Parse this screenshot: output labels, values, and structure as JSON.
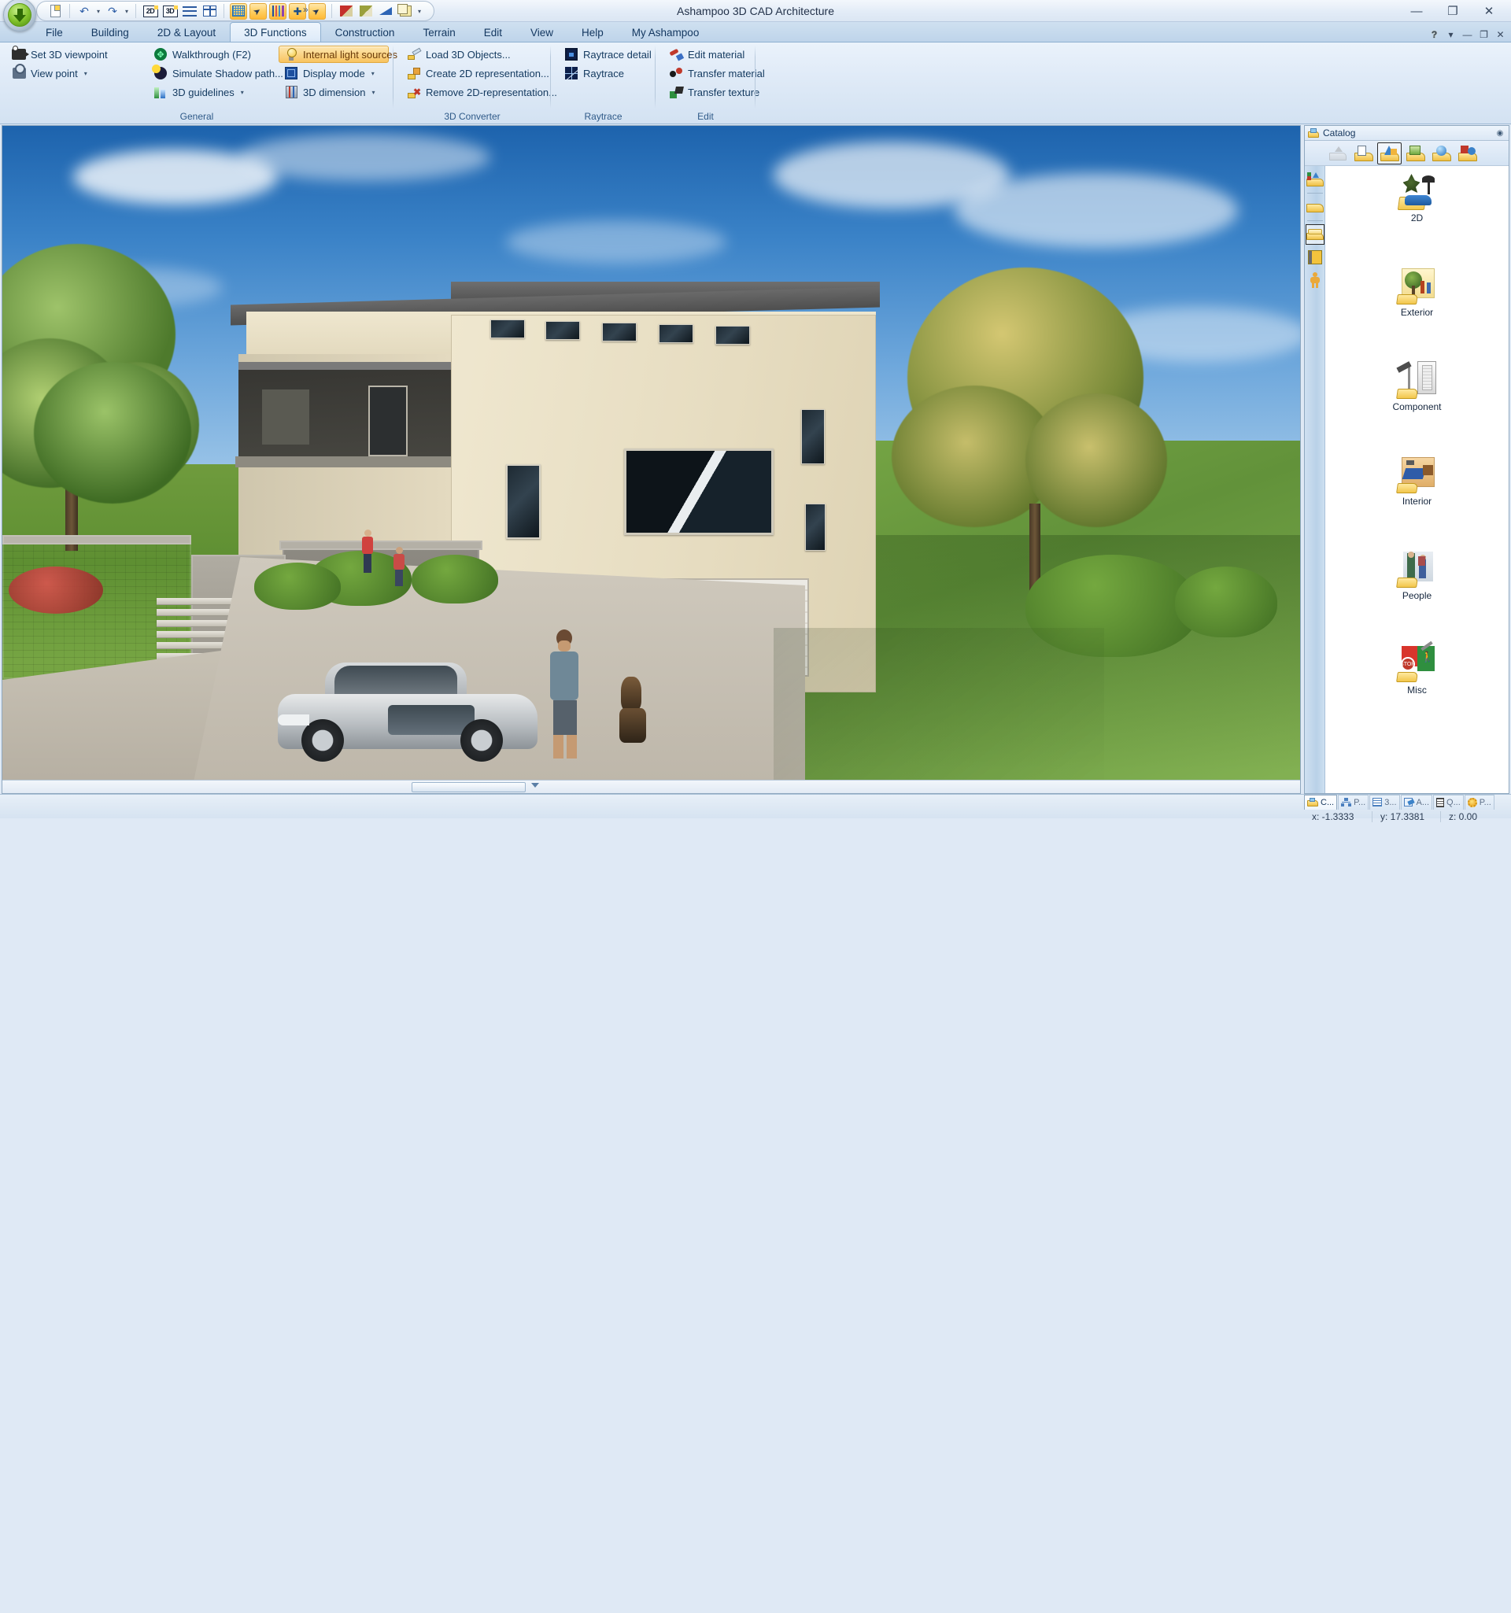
{
  "window": {
    "title": "Ashampoo 3D CAD Architecture",
    "controls": {
      "minimize": "—",
      "maximize": "❐",
      "close": "✕"
    }
  },
  "quick_access": {
    "orb": "app-menu-orb",
    "items": [
      {
        "name": "new-document",
        "icon": "document-icon",
        "active": false
      },
      {
        "name": "undo",
        "icon": "undo-icon",
        "active": false,
        "has_dropdown": true
      },
      {
        "name": "redo",
        "icon": "redo-icon",
        "active": false,
        "has_dropdown": true
      },
      {
        "name": "view-2d",
        "icon": "2d-icon",
        "label": "2D",
        "active": false
      },
      {
        "name": "view-3d",
        "icon": "3d-icon",
        "label": "3D",
        "active": false
      },
      {
        "name": "horizontal-split",
        "icon": "rows-icon",
        "active": false
      },
      {
        "name": "vertical-split",
        "icon": "split-icon",
        "active": false
      },
      {
        "name": "grid",
        "icon": "grid-icon",
        "active": true
      },
      {
        "name": "select-pointer",
        "icon": "pointer-select-icon",
        "active": true
      },
      {
        "name": "layers",
        "icon": "color-bars-icon",
        "active": true
      },
      {
        "name": "snap",
        "icon": "snap-icon",
        "active": true
      },
      {
        "name": "arrow-select",
        "icon": "arrow-icon",
        "active": true
      },
      {
        "name": "wall-red",
        "icon": "red-wall-icon",
        "active": false
      },
      {
        "name": "wall-olive",
        "icon": "olive-wall-icon",
        "active": false
      },
      {
        "name": "roof",
        "icon": "blue-wedge-icon",
        "active": false
      },
      {
        "name": "copy",
        "icon": "copy-icon",
        "active": false,
        "has_dropdown": true
      }
    ],
    "overflow_caret": "»"
  },
  "tabs": [
    {
      "label": "File",
      "active": false
    },
    {
      "label": "Building",
      "active": false
    },
    {
      "label": "2D & Layout",
      "active": false
    },
    {
      "label": "3D Functions",
      "active": true
    },
    {
      "label": "Construction",
      "active": false
    },
    {
      "label": "Terrain",
      "active": false
    },
    {
      "label": "Edit",
      "active": false
    },
    {
      "label": "View",
      "active": false
    },
    {
      "label": "Help",
      "active": false
    },
    {
      "label": "My Ashampoo",
      "active": false
    }
  ],
  "tab_right_controls": [
    {
      "name": "help-button",
      "glyph": "?"
    },
    {
      "name": "ribbon-options-caret",
      "glyph": "▾"
    },
    {
      "name": "ribbon-minimize",
      "glyph": "—"
    },
    {
      "name": "ribbon-restore",
      "glyph": "❐"
    },
    {
      "name": "ribbon-close",
      "glyph": "✕"
    }
  ],
  "ribbon": {
    "groups": [
      {
        "name": "general",
        "label": "General",
        "items": [
          {
            "name": "set-3d-viewpoint",
            "label": "Set 3D viewpoint",
            "icon": "camera-icon",
            "dropdown": false,
            "highlight": false
          },
          {
            "name": "view-point-button",
            "label": "View point",
            "icon": "viewpoint-icon",
            "dropdown": true,
            "highlight": false
          },
          {
            "name": "walkthrough",
            "label": "Walkthrough (F2)",
            "icon": "walk-icon",
            "dropdown": false,
            "highlight": false
          },
          {
            "name": "simulate-shadow-path",
            "label": "Simulate Shadow path...",
            "icon": "sun-shadow-icon",
            "dropdown": false,
            "highlight": false
          },
          {
            "name": "3d-guidelines",
            "label": "3D guidelines",
            "icon": "guideline-icon",
            "dropdown": true,
            "highlight": false
          },
          {
            "name": "internal-light-sources",
            "label": "Internal light sources",
            "icon": "lightbulb-icon",
            "dropdown": false,
            "highlight": true
          },
          {
            "name": "display-mode",
            "label": "Display mode",
            "icon": "cube-icon",
            "dropdown": true,
            "highlight": false
          },
          {
            "name": "3d-dimension",
            "label": "3D dimension",
            "icon": "dimension-cube-icon",
            "dropdown": true,
            "highlight": false
          }
        ],
        "viewpoint_field": {
          "name": "view-point-combo",
          "label": "View point",
          "value": "",
          "placeholder": ""
        }
      },
      {
        "name": "3d-converter",
        "label": "3D Converter",
        "items": [
          {
            "name": "load-3d-objects",
            "label": "Load 3D Objects...",
            "icon": "folder-open-icon",
            "dropdown": false,
            "highlight": false
          },
          {
            "name": "create-2d-representation",
            "label": "Create 2D representation...",
            "icon": "create-2d-icon",
            "dropdown": false,
            "highlight": false
          },
          {
            "name": "remove-2d-representation",
            "label": "Remove 2D-representation...",
            "icon": "remove-2d-icon",
            "dropdown": false,
            "highlight": false
          }
        ]
      },
      {
        "name": "raytrace",
        "label": "Raytrace",
        "items": [
          {
            "name": "raytrace-detail",
            "label": "Raytrace detail",
            "icon": "raytrace-detail-icon",
            "dropdown": false,
            "highlight": false
          },
          {
            "name": "raytrace",
            "label": "Raytrace",
            "icon": "raytrace-icon",
            "dropdown": false,
            "highlight": false
          }
        ]
      },
      {
        "name": "edit",
        "label": "Edit",
        "items": [
          {
            "name": "edit-material",
            "label": "Edit material",
            "icon": "edit-material-icon",
            "dropdown": false,
            "highlight": false
          },
          {
            "name": "transfer-material",
            "label": "Transfer material",
            "icon": "transfer-material-icon",
            "dropdown": false,
            "highlight": false
          },
          {
            "name": "transfer-texture",
            "label": "Transfer texture",
            "icon": "transfer-texture-icon",
            "dropdown": false,
            "highlight": false
          }
        ]
      }
    ]
  },
  "viewport": {
    "name": "3d-render-view",
    "description": "3D rendered architectural scene: modern two-storey house with flat roof, garage, stone retaining walls, stairs, trees, lawn, parked silver car, people and a dog",
    "scrollbar": {
      "name": "viewport-horizontal-scrollbar"
    }
  },
  "catalog": {
    "title": "Catalog",
    "title_icon": "catalog-folder-icon",
    "pin_icon": "auto-hide-icon",
    "toolbar": [
      {
        "name": "catalog-up",
        "icon": "up-arrow-icon",
        "selected": false,
        "disabled": true
      },
      {
        "name": "catalog-windows",
        "icon": "window-folder-icon",
        "selected": false
      },
      {
        "name": "catalog-3d-objects",
        "icon": "3d-objects-folder-icon",
        "selected": true
      },
      {
        "name": "catalog-textures",
        "icon": "texture-folder-icon",
        "selected": false
      },
      {
        "name": "catalog-materials",
        "icon": "material-folder-icon",
        "selected": false
      },
      {
        "name": "catalog-symbols",
        "icon": "symbol-folder-icon",
        "selected": false
      }
    ],
    "side_buttons": [
      {
        "name": "catalog-side-symbols",
        "icon": "symbols-folder-icon",
        "selected": false
      },
      {
        "name": "catalog-side-favorites",
        "icon": "folder-icon",
        "selected": false
      },
      {
        "name": "catalog-side-objects",
        "icon": "objects-folder-icon",
        "selected": true
      },
      {
        "name": "catalog-side-books",
        "icon": "book-icon",
        "selected": false
      },
      {
        "name": "catalog-side-people",
        "icon": "person-icon",
        "selected": false
      }
    ],
    "items": [
      {
        "name": "catalog-item-2d",
        "label": "2D",
        "icon": "2d-category-icon"
      },
      {
        "name": "catalog-item-exterior",
        "label": "Exterior",
        "icon": "exterior-category-icon"
      },
      {
        "name": "catalog-item-component",
        "label": "Component",
        "icon": "component-category-icon"
      },
      {
        "name": "catalog-item-interior",
        "label": "Interior",
        "icon": "interior-category-icon"
      },
      {
        "name": "catalog-item-people",
        "label": "People",
        "icon": "people-category-icon"
      },
      {
        "name": "catalog-item-misc",
        "label": "Misc",
        "icon": "misc-category-icon"
      }
    ]
  },
  "document_tabs": [
    {
      "name": "doc-tab-catalog",
      "label": "C...",
      "icon": "catalog-icon",
      "active": true
    },
    {
      "name": "doc-tab-project",
      "label": "P...",
      "icon": "project-tree-icon",
      "active": false
    },
    {
      "name": "doc-tab-3d",
      "label": "3...",
      "icon": "3d-view-icon",
      "active": false
    },
    {
      "name": "doc-tab-attributes",
      "label": "A...",
      "icon": "attributes-icon",
      "active": false
    },
    {
      "name": "doc-tab-quantities",
      "label": "Q...",
      "icon": "quantities-icon",
      "active": false
    },
    {
      "name": "doc-tab-properties",
      "label": "P...",
      "icon": "properties-icon",
      "active": false
    }
  ],
  "status": {
    "x": "x: -1.3333",
    "y": "y: 17.3381",
    "z": "z: 0.00"
  },
  "colors": {
    "accent_highlight": "#f8c35f",
    "ribbon_text": "#13395f",
    "tab_active_bg": "#eef5fc",
    "catalog_bg": "#ffffff"
  }
}
